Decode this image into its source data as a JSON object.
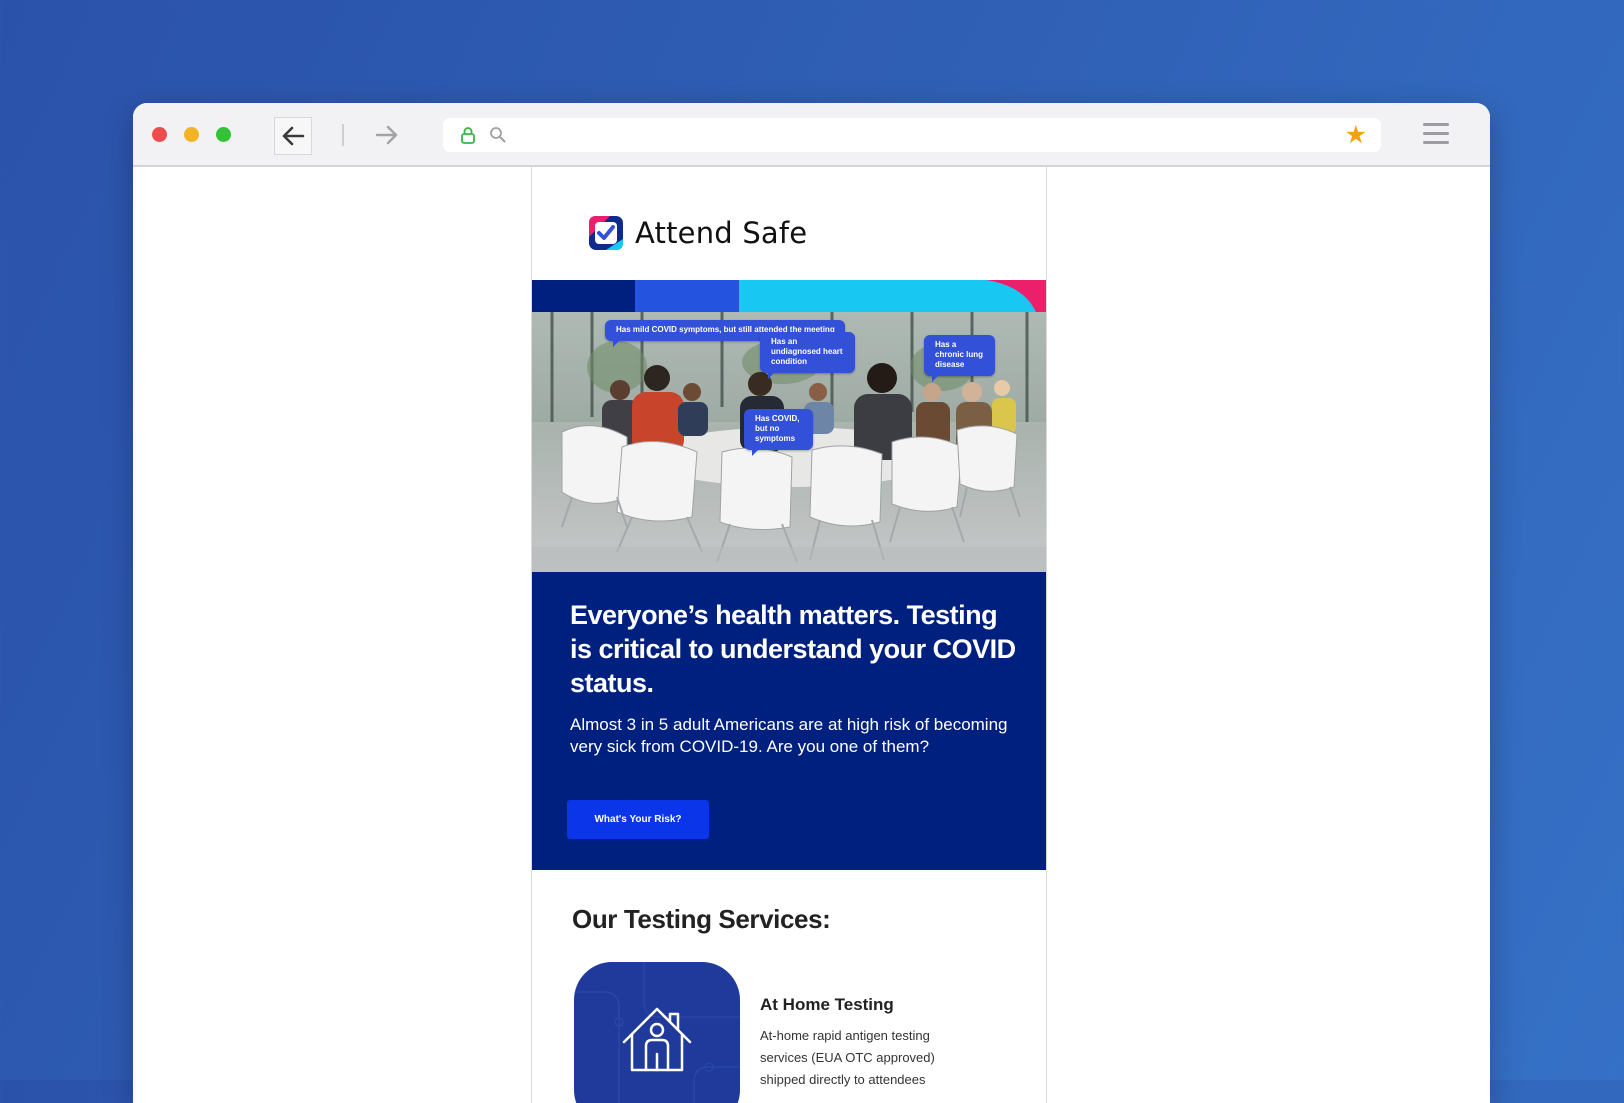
{
  "browser": {
    "url": ""
  },
  "email": {
    "brand_name": "Attend Safe",
    "hero": {
      "bubbles": [
        "Has mild COVID symptoms, but still attended the meeting",
        "Has an undiagnosed heart condition",
        "Has a chronic lung disease",
        "Has COVID, but no symptoms"
      ]
    },
    "headline": "Everyone’s health matters. Testing is critical to understand your COVID status.",
    "subtext": "Almost 3 in 5 adult Americans are at high risk of becoming very sick from COVID-19. Are you one of them?",
    "cta_label": "What's Your Risk?",
    "services": {
      "title": "Our Testing Services:",
      "items": [
        {
          "icon": "house-person-icon",
          "heading": "At Home Testing",
          "description": "At-home rapid antigen testing services (EUA OTC approved) shipped directly to attendees"
        }
      ]
    }
  },
  "colors": {
    "page_background": "#2f5fb5",
    "navy": "#00207f",
    "cta_blue": "#0b35e8",
    "stripe_cyan": "#18c8f2",
    "stripe_magenta": "#ec1f6b",
    "bubble_blue": "#3350d8",
    "star": "#f2a20f"
  }
}
